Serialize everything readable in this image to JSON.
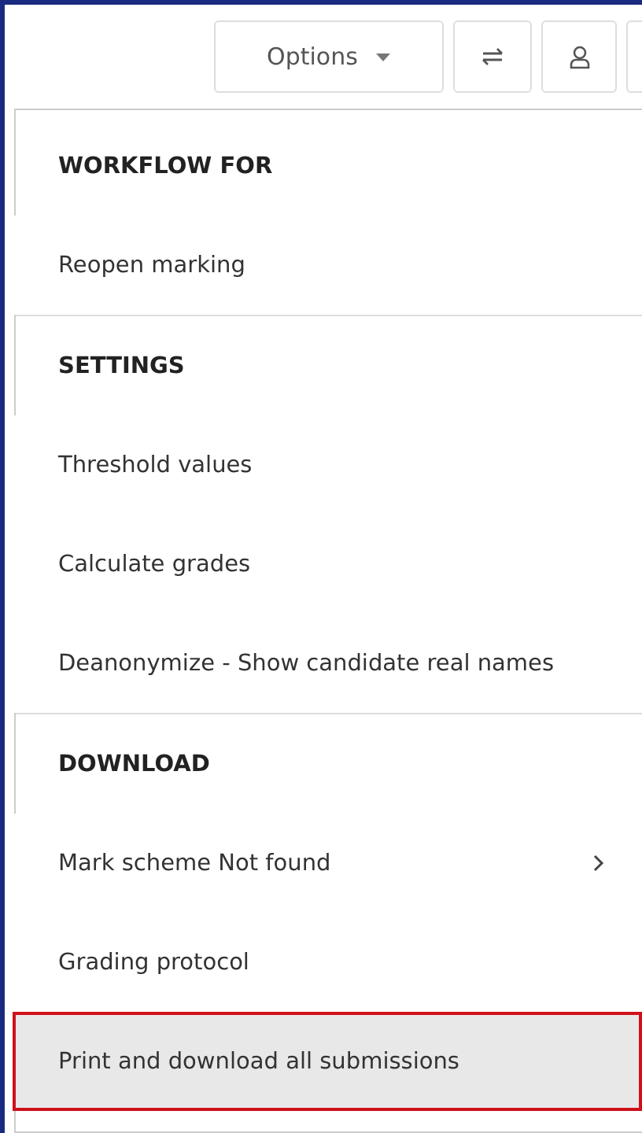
{
  "toolbar": {
    "options_button": {
      "label": "Options"
    }
  },
  "menu": [
    {
      "kind": "header",
      "label": "WORKFLOW FOR"
    },
    {
      "kind": "item",
      "label": "Reopen marking",
      "selected": false,
      "submenu": false
    },
    {
      "kind": "divider"
    },
    {
      "kind": "header",
      "label": "SETTINGS"
    },
    {
      "kind": "item",
      "label": "Threshold values",
      "selected": false,
      "submenu": false
    },
    {
      "kind": "item",
      "label": "Calculate grades",
      "selected": false,
      "submenu": false
    },
    {
      "kind": "item",
      "label": "Deanonymize - Show candidate real names",
      "selected": false,
      "submenu": false
    },
    {
      "kind": "divider"
    },
    {
      "kind": "header",
      "label": "DOWNLOAD"
    },
    {
      "kind": "item",
      "label": "Mark scheme Not found",
      "selected": false,
      "submenu": true
    },
    {
      "kind": "item",
      "label": "Grading protocol",
      "selected": false,
      "submenu": false
    },
    {
      "kind": "item",
      "label": "Print and download all submissions",
      "selected": true,
      "submenu": false
    }
  ]
}
